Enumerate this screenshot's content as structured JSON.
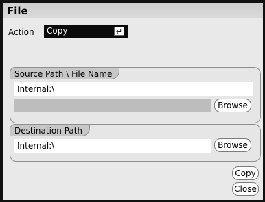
{
  "window": {
    "title": "File"
  },
  "action": {
    "label": "Action",
    "value": "Copy",
    "enter_icon": "↵"
  },
  "source": {
    "tab": "Source Path \\ File Name",
    "path_value": "Internal:\\",
    "secondary_value": "",
    "browse_label": "Browse"
  },
  "destination": {
    "tab": "Destination Path",
    "path_value": "Internal:\\",
    "browse_label": "Browse"
  },
  "buttons": {
    "copy_label": "Copy",
    "close_label": "Close"
  }
}
